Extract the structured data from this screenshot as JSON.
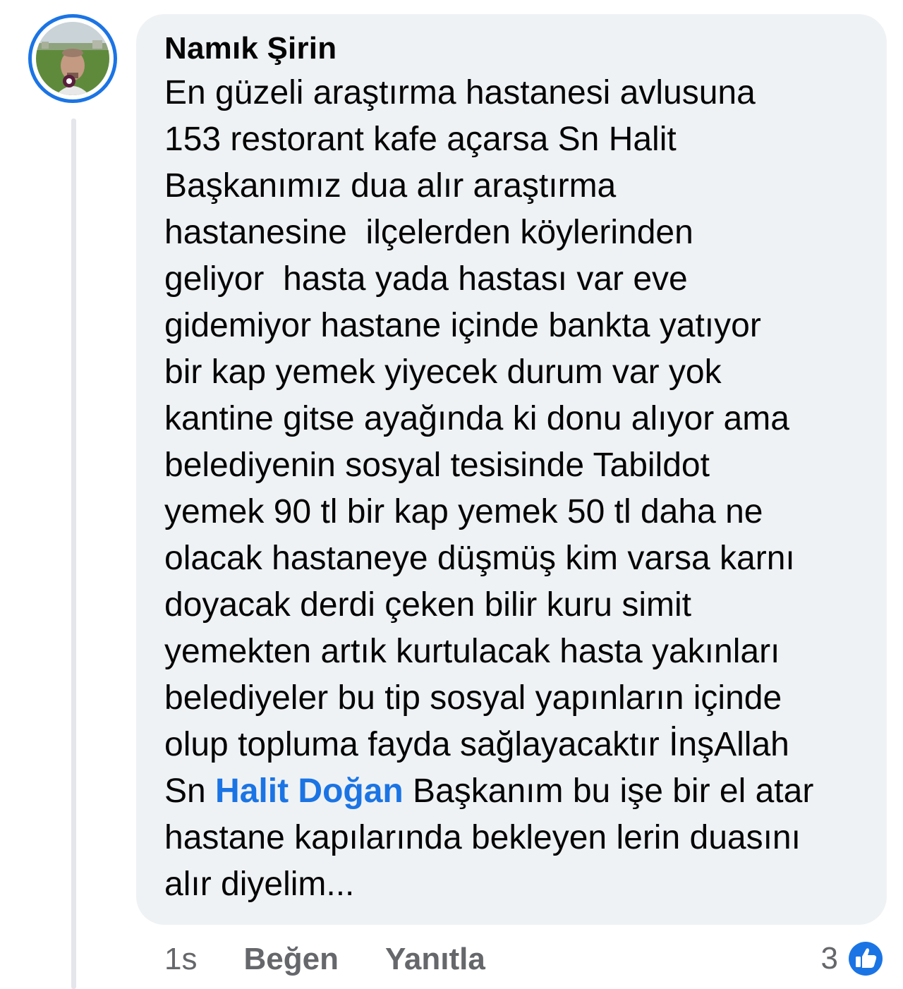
{
  "comment": {
    "author": "Namık Şirin",
    "lines": [
      "En güzeli araştırma hastanesi avlusuna",
      "153 restorant kafe açarsa Sn Halit",
      "Başkanımız dua alır araştırma",
      "hastanesine  ilçelerden köylerinden",
      "geliyor  hasta yada hastası var eve",
      "gidemiyor hastane içinde bankta yatıyor",
      "bir kap yemek yiyecek durum var yok",
      "kantine gitse ayağında ki donu alıyor ama",
      "belediyenin sosyal tesisinde Tabildot",
      "yemek 90 tl bir kap yemek 50 tl daha ne",
      "olacak hastaneye düşmüş kim varsa karnı",
      "doyacak derdi çeken bilir kuru simit",
      "yemekten artık kurtulacak hasta yakınları",
      "belediyeler bu tip sosyal yapınların içinde",
      "olup topluma fayda sağlayacaktır İnşAllah"
    ],
    "mention_prefix": "Sn ",
    "mention": "Halit Doğan",
    "mention_suffix": " Başkanım bu işe bir el atar",
    "closing_lines": [
      "hastane kapılarında bekleyen lerin duasını",
      "alır diyelim..."
    ]
  },
  "actions": {
    "timestamp": "1s",
    "like_label": "Beğen",
    "reply_label": "Yanıtla"
  },
  "reactions": {
    "count": "3",
    "icon": "like-icon"
  },
  "colors": {
    "accent": "#1b74e4",
    "bubble": "#eff2f5",
    "text": "#050505",
    "muted": "#65676b",
    "thread_line": "#e4e6eb"
  }
}
